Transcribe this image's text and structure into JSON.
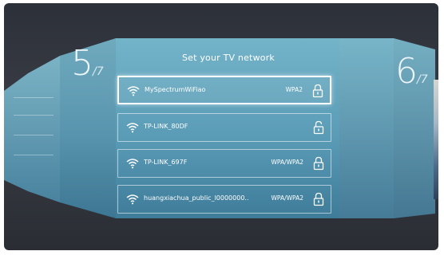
{
  "header": {
    "title": "Set your TV network"
  },
  "steps": {
    "current": {
      "number": "5",
      "total": "/7"
    },
    "next": {
      "number": "6",
      "total": "/7"
    }
  },
  "left_panel": {
    "items": [
      "",
      "",
      "",
      ""
    ]
  },
  "networks": [
    {
      "ssid": "MySpectrumWiFiao",
      "security": "WPA2",
      "lock": "lock-icon",
      "selected": true
    },
    {
      "ssid": "TP-LINK_80DF",
      "security": "",
      "lock": "unlock-icon",
      "selected": false
    },
    {
      "ssid": "TP-LINK_697F",
      "security": "WPA/WPA2",
      "lock": "lock-icon",
      "selected": false
    },
    {
      "ssid": "huangxiachua_public_l0000000..",
      "security": "WPA/WPA2",
      "lock": "lock-icon",
      "selected": false
    }
  ],
  "colors": {
    "panel_top": "#6fb3c8",
    "panel_bottom": "#3f7d9b",
    "background": "#2f333b",
    "text": "#ffffff"
  }
}
